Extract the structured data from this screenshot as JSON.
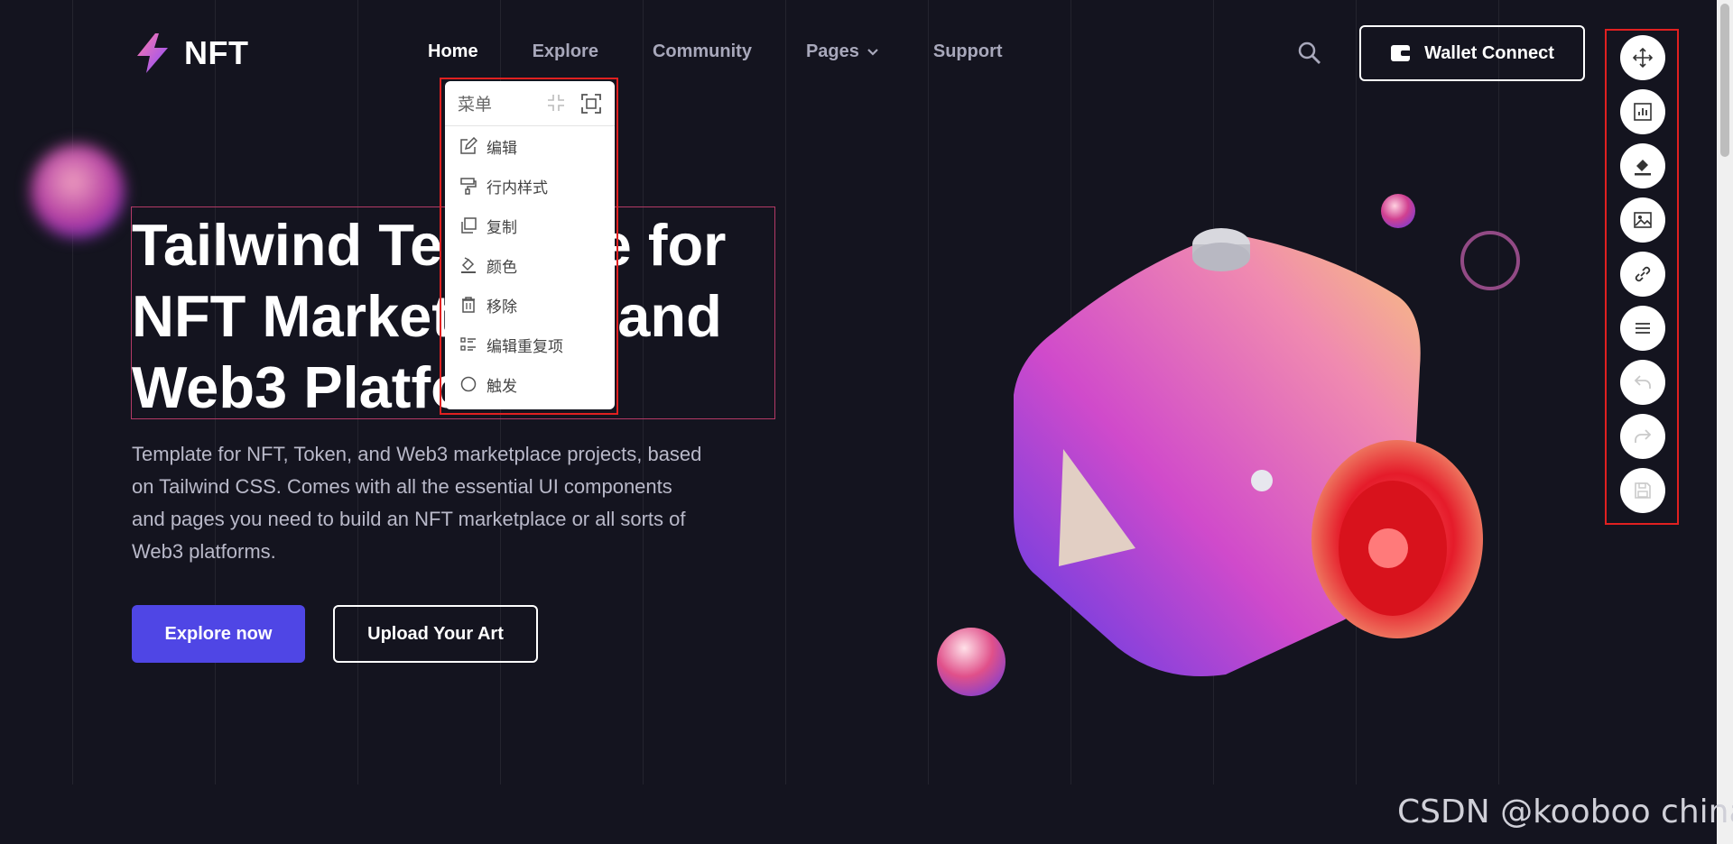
{
  "header": {
    "logo_text": "NFT",
    "nav": [
      {
        "label": "Home",
        "active": true
      },
      {
        "label": "Explore"
      },
      {
        "label": "Community"
      },
      {
        "label": "Pages",
        "has_dropdown": true
      },
      {
        "label": "Support"
      }
    ],
    "wallet_label": "Wallet Connect"
  },
  "hero": {
    "title_lines": [
      "Tailwind Template for",
      "NFT Marketplace and",
      "Web3 Platform"
    ],
    "description": "Template for NFT, Token, and Web3 marketplace projects, based on Tailwind CSS. Comes with all the essential UI components and pages you need to build an NFT marketplace or all sorts of Web3 platforms.",
    "primary_button": "Explore now",
    "secondary_button": "Upload Your Art"
  },
  "context_menu": {
    "title": "菜单",
    "items": [
      {
        "label": "编辑",
        "icon": "edit-icon"
      },
      {
        "label": "行内样式",
        "icon": "paint-roller-icon"
      },
      {
        "label": "复制",
        "icon": "copy-icon"
      },
      {
        "label": "颜色",
        "icon": "fill-color-icon"
      },
      {
        "label": "移除",
        "icon": "trash-icon"
      },
      {
        "label": "编辑重复项",
        "icon": "list-icon"
      },
      {
        "label": "触发",
        "icon": "circle-icon"
      }
    ]
  },
  "toolbar": {
    "tools": [
      "move-icon",
      "chart-icon",
      "fill-color-icon",
      "image-icon",
      "link-icon",
      "menu-icon",
      "undo-icon",
      "redo-icon",
      "save-icon"
    ],
    "disabled": [
      "undo-icon",
      "redo-icon",
      "save-icon"
    ]
  },
  "watermark": "CSDN @kooboo china",
  "colors": {
    "background": "#14141f",
    "primary": "#4f46e5",
    "highlight_border": "#e02020",
    "selection_border": "#b33a66"
  }
}
